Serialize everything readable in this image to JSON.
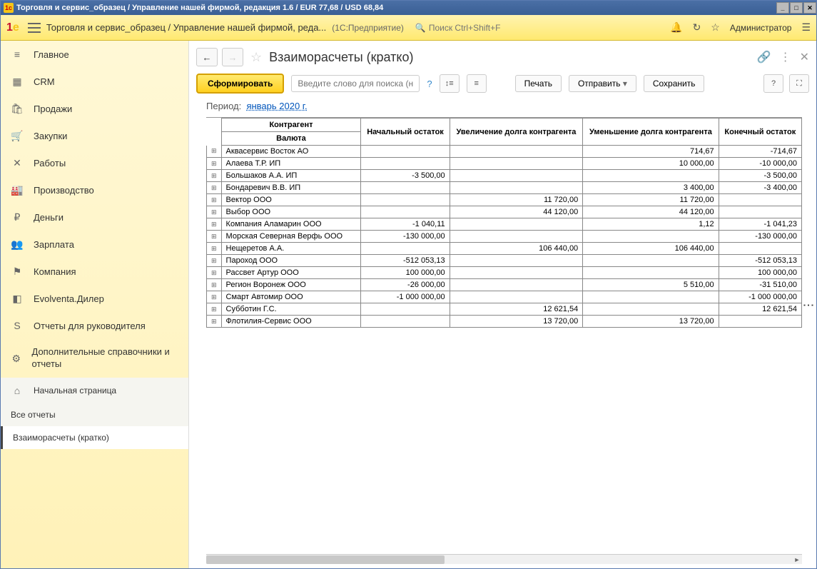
{
  "window": {
    "title": "Торговля и сервис_образец / Управление нашей фирмой, редакция 1.6 / EUR 77,68 / USD 68,84"
  },
  "topbar": {
    "crumb": "Торговля и сервис_образец / Управление нашей фирмой, реда...",
    "app_tag": "(1С:Предприятие)",
    "search_placeholder": "Поиск Ctrl+Shift+F",
    "user": "Администратор"
  },
  "sidebar": {
    "items": [
      {
        "icon": "≡",
        "label": "Главное"
      },
      {
        "icon": "▦",
        "label": "CRM"
      },
      {
        "icon": "🛍",
        "label": "Продажи"
      },
      {
        "icon": "🛒",
        "label": "Закупки"
      },
      {
        "icon": "✕",
        "label": "Работы"
      },
      {
        "icon": "🏭",
        "label": "Производство"
      },
      {
        "icon": "₽",
        "label": "Деньги"
      },
      {
        "icon": "👥",
        "label": "Зарплата"
      },
      {
        "icon": "⚑",
        "label": "Компания"
      },
      {
        "icon": "◧",
        "label": "Evolventa.Дилер"
      },
      {
        "icon": "S",
        "label": "Отчеты для руководителя"
      },
      {
        "icon": "⚙",
        "label": "Дополнительные справочники и отчеты"
      }
    ],
    "secondary": [
      {
        "icon": "⌂",
        "label": "Начальная страница"
      },
      {
        "icon": "",
        "label": "Все отчеты"
      },
      {
        "icon": "",
        "label": "Взаиморасчеты (кратко)",
        "active": true
      }
    ]
  },
  "page": {
    "title": "Взаиморасчеты (кратко)",
    "generate_btn": "Сформировать",
    "search_placeholder": "Введите слово для поиска (н...",
    "print_btn": "Печать",
    "send_btn": "Отправить",
    "save_btn": "Сохранить",
    "period_label": "Период:",
    "period_value": "январь 2020 г."
  },
  "table": {
    "headers": {
      "contragent": "Контрагент",
      "currency": "Валюта",
      "start_balance": "Начальный остаток",
      "debt_increase": "Увеличение долга контрагента",
      "debt_decrease": "Уменьшение долга контрагента",
      "end_balance": "Конечный остаток"
    },
    "rows": [
      {
        "name": "Аквасервис Восток АО",
        "start": "",
        "inc": "",
        "dec": "714,67",
        "end": "-714,67"
      },
      {
        "name": "Алаева Т.Р. ИП",
        "start": "",
        "inc": "",
        "dec": "10 000,00",
        "end": "-10 000,00"
      },
      {
        "name": "Большаков А.А. ИП",
        "start": "-3 500,00",
        "inc": "",
        "dec": "",
        "end": "-3 500,00"
      },
      {
        "name": "Бондаревич В.В. ИП",
        "start": "",
        "inc": "",
        "dec": "3 400,00",
        "end": "-3 400,00"
      },
      {
        "name": "Вектор ООО",
        "start": "",
        "inc": "11 720,00",
        "dec": "11 720,00",
        "end": ""
      },
      {
        "name": "Выбор ООО",
        "start": "",
        "inc": "44 120,00",
        "dec": "44 120,00",
        "end": ""
      },
      {
        "name": "Компания Аламарин ООО",
        "start": "-1 040,11",
        "inc": "",
        "dec": "1,12",
        "end": "-1 041,23"
      },
      {
        "name": "Морская Северная Верфь ООО",
        "start": "-130 000,00",
        "inc": "",
        "dec": "",
        "end": "-130 000,00"
      },
      {
        "name": "Нещеретов А.А.",
        "start": "",
        "inc": "106 440,00",
        "dec": "106 440,00",
        "end": ""
      },
      {
        "name": "Пароход ООО",
        "start": "-512 053,13",
        "inc": "",
        "dec": "",
        "end": "-512 053,13"
      },
      {
        "name": "Рассвет Артур ООО",
        "start": "100 000,00",
        "inc": "",
        "dec": "",
        "end": "100 000,00"
      },
      {
        "name": "Регион Воронеж ООО",
        "start": "-26 000,00",
        "inc": "",
        "dec": "5 510,00",
        "end": "-31 510,00"
      },
      {
        "name": "Смарт Автомир ООО",
        "start": "-1 000 000,00",
        "inc": "",
        "dec": "",
        "end": "-1 000 000,00"
      },
      {
        "name": "Субботин Г.С.",
        "start": "",
        "inc": "12 621,54",
        "dec": "",
        "end": "12 621,54"
      },
      {
        "name": "Флотилия-Сервис ООО",
        "start": "",
        "inc": "13 720,00",
        "dec": "13 720,00",
        "end": ""
      }
    ]
  }
}
